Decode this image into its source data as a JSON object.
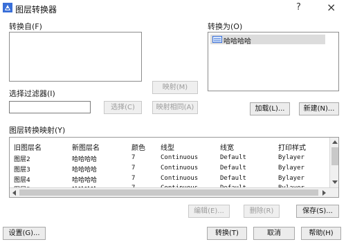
{
  "title": "图层转换器",
  "title_controls": {
    "help": "?",
    "close": "×"
  },
  "convert_from": {
    "label": "转换自(F)",
    "filter_label": "选择过滤器(I)",
    "filter_value": "",
    "select_button": "选择(C)"
  },
  "convert_to": {
    "label": "转换为(O)",
    "items": [
      "哈哈哈哈"
    ],
    "load_button": "加载(L)...",
    "new_button": "新建(N)..."
  },
  "map_buttons": {
    "map": "映射(M)",
    "map_same": "映射相同(A)"
  },
  "mappings": {
    "label": "图层转换映射(Y)",
    "columns": [
      "旧图层名",
      "新图层名",
      "颜色",
      "线型",
      "线宽",
      "打印样式"
    ],
    "rows": [
      [
        "图层2",
        "哈哈哈哈",
        "7",
        "Continuous",
        "Default",
        "Bylayer"
      ],
      [
        "图层3",
        "哈哈哈哈",
        "7",
        "Continuous",
        "Default",
        "Bylayer"
      ],
      [
        "图层4",
        "哈哈哈哈",
        "7",
        "Continuous",
        "Default",
        "Bylayer"
      ],
      [
        "图层5",
        "哈哈哈哈",
        "7",
        "Continuous",
        "Default",
        "Bylayer"
      ]
    ],
    "edit_button": "编辑(E)...",
    "delete_button": "删除(R)",
    "save_button": "保存(S)..."
  },
  "footer": {
    "settings_button": "设置(G)...",
    "convert_button": "转换(T)",
    "cancel_button": "取消",
    "help_button": "帮助(H)"
  },
  "colors": {
    "accent": "#3a6fd8",
    "selection": "#dcdcdc"
  },
  "icons": [
    "app-layer-icon",
    "layer-icon",
    "scroll-up-icon",
    "scroll-down-icon",
    "scroll-left-icon",
    "scroll-right-icon"
  ]
}
